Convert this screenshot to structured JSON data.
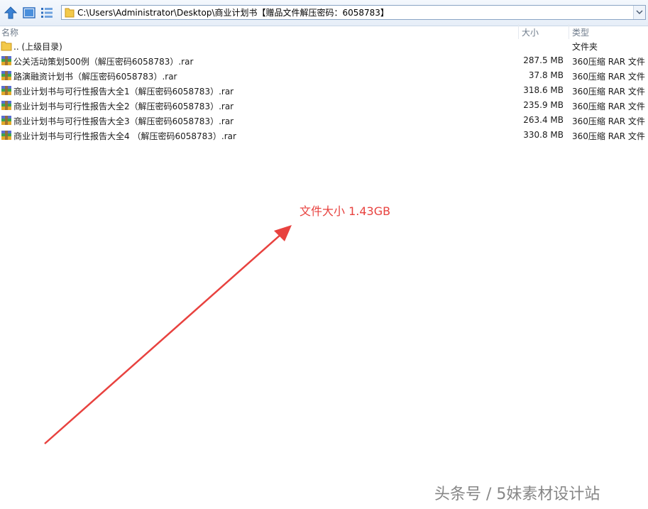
{
  "address_bar": {
    "path": "C:\\Users\\Administrator\\Desktop\\商业计划书【赠品文件解压密码：6058783】"
  },
  "columns": {
    "name": "名称",
    "size": "大小",
    "type": "类型"
  },
  "rows": [
    {
      "icon": "folder-icon",
      "name": ".. (上级目录)",
      "size": "",
      "type": "文件夹"
    },
    {
      "icon": "rar-archive-icon",
      "name": "公关活动策划500例（解压密码6058783）.rar",
      "size": "287.5 MB",
      "type": "360压缩 RAR 文件"
    },
    {
      "icon": "rar-archive-icon",
      "name": "路演融资计划书（解压密码6058783）.rar",
      "size": "37.8 MB",
      "type": "360压缩 RAR 文件"
    },
    {
      "icon": "rar-archive-icon",
      "name": "商业计划书与可行性报告大全1（解压密码6058783）.rar",
      "size": "318.6 MB",
      "type": "360压缩 RAR 文件"
    },
    {
      "icon": "rar-archive-icon",
      "name": "商业计划书与可行性报告大全2（解压密码6058783）.rar",
      "size": "235.9 MB",
      "type": "360压缩 RAR 文件"
    },
    {
      "icon": "rar-archive-icon",
      "name": "商业计划书与可行性报告大全3（解压密码6058783）.rar",
      "size": "263.4 MB",
      "type": "360压缩 RAR 文件"
    },
    {
      "icon": "rar-archive-icon",
      "name": "商业计划书与可行性报告大全4 （解压密码6058783）.rar",
      "size": "330.8 MB",
      "type": "360压缩 RAR 文件"
    }
  ],
  "annotation": {
    "text": "文件大小 1.43GB",
    "color": "#e8423f"
  },
  "watermark": {
    "text": "头条号 / 5妹素材设计站"
  },
  "icons": {
    "toolbar": [
      "up-arrow-icon",
      "view-icon",
      "list-view-icon"
    ],
    "address": "folder-icon",
    "dropdown": "chevron-down-icon"
  }
}
